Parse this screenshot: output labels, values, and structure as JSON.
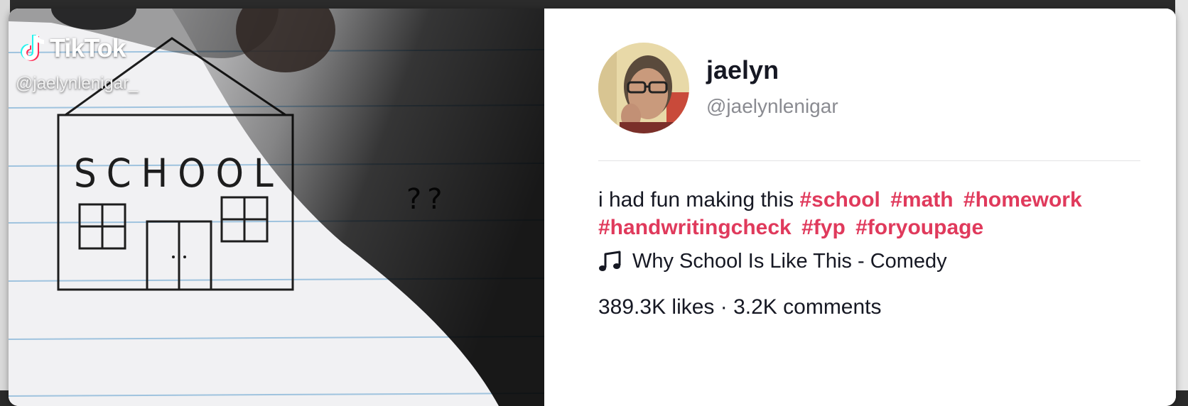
{
  "video": {
    "brand": "TikTok",
    "handle": "@jaelynlenigar_",
    "drawing_text": "SCHOOL",
    "question_marks": "??"
  },
  "author": {
    "display_name": "jaelyn",
    "username": "@jaelynlenigar"
  },
  "caption": {
    "text": "i had fun making this",
    "hashtags": [
      "#school",
      "#math",
      "#homework",
      "#handwritingcheck",
      "#fyp",
      "#foryoupage"
    ]
  },
  "music": {
    "title": "Why School Is Like This - Comedy"
  },
  "stats": {
    "summary": "389.3K likes · 3.2K comments"
  },
  "colors": {
    "hashtag": "#e03a5c",
    "text": "#161823",
    "muted": "#8a8b91"
  }
}
